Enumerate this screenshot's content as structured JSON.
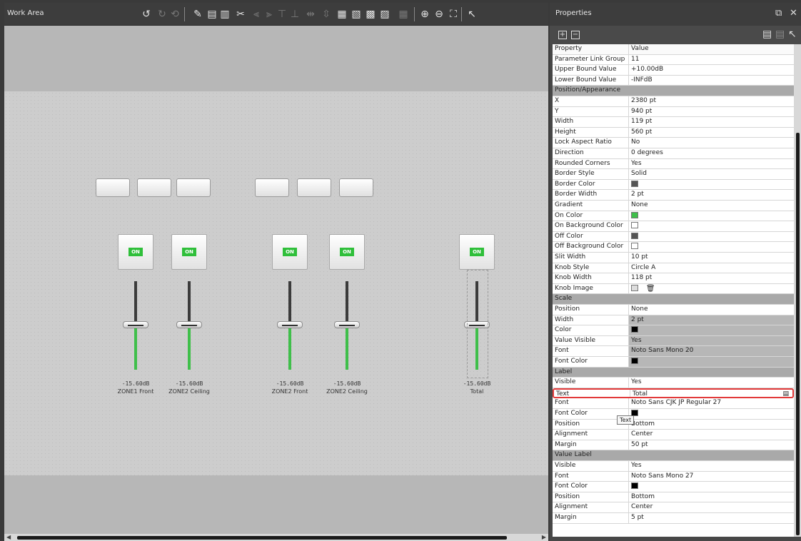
{
  "work_area": {
    "title": "Work Area",
    "toolbar": [
      "undo-icon",
      "redo-icon",
      "history-icon",
      "edit-icon",
      "copy-icon",
      "paste-icon",
      "cut-icon",
      "align-left-icon",
      "align-right-icon",
      "align-top-icon",
      "align-bottom-icon",
      "distribute-horizontal-icon",
      "distribute-vertical-icon",
      "group-icon",
      "ungroup-icon",
      "front-icon",
      "back-icon",
      "grid-icon",
      "zoom-in-icon",
      "zoom-out-icon",
      "fit-icon",
      "pointer-icon"
    ],
    "top_buttons": 6,
    "faders": [
      {
        "on_label": "ON",
        "value": "-15.60dB",
        "label": "ZONE1 Front",
        "level": 0.52
      },
      {
        "on_label": "ON",
        "value": "-15.60dB",
        "label": "ZONE2 Ceiling",
        "level": 0.52
      },
      {
        "on_label": "ON",
        "value": "-15.60dB",
        "label": "ZONE2 Front",
        "level": 0.52
      },
      {
        "on_label": "ON",
        "value": "-15.60dB",
        "label": "ZONE2 Ceiling",
        "level": 0.52
      },
      {
        "on_label": "ON",
        "value": "-15.60dB",
        "label": "Total",
        "level": 0.52
      }
    ]
  },
  "properties": {
    "title": "Properties",
    "header": {
      "property": "Property",
      "value": "Value"
    },
    "tooltip": "Text",
    "rows": [
      {
        "k": "Parameter Link Group",
        "v": "11"
      },
      {
        "k": "Upper Bound Value",
        "v": "+10.00dB"
      },
      {
        "k": "Lower Bound Value",
        "v": "-INFdB"
      },
      {
        "cat": "Position/Appearance"
      },
      {
        "k": "X",
        "v": "2380 pt"
      },
      {
        "k": "Y",
        "v": "940 pt"
      },
      {
        "k": "Width",
        "v": "119 pt"
      },
      {
        "k": "Height",
        "v": "560 pt"
      },
      {
        "k": "Lock Aspect Ratio",
        "v": "No"
      },
      {
        "k": "Direction",
        "v": "0 degrees"
      },
      {
        "k": "Rounded Corners",
        "v": "Yes"
      },
      {
        "k": "Border Style",
        "v": "Solid"
      },
      {
        "k": "Border Color",
        "swatch": "#555555"
      },
      {
        "k": "Border Width",
        "v": "2 pt"
      },
      {
        "k": "Gradient",
        "v": "None"
      },
      {
        "k": "On Color",
        "swatch": "#3fbf4a"
      },
      {
        "k": "On Background Color",
        "swatch": "#ffffff"
      },
      {
        "k": "Off Color",
        "swatch": "#555555"
      },
      {
        "k": "Off Background Color",
        "swatch": "#ffffff"
      },
      {
        "k": "Slit Width",
        "v": "10 pt"
      },
      {
        "k": "Knob Style",
        "v": "Circle A"
      },
      {
        "k": "Knob Width",
        "v": "118 pt"
      },
      {
        "k": "Knob Image",
        "knob": true
      },
      {
        "cat": "Scale"
      },
      {
        "k": "Position",
        "v": "None"
      },
      {
        "k": "Width",
        "v": "2 pt",
        "dim": true
      },
      {
        "k": "Color",
        "swatch": "#000000",
        "dim": true
      },
      {
        "k": "Value Visible",
        "v": "Yes",
        "dim": true
      },
      {
        "k": "Font",
        "v": "Noto Sans Mono 20",
        "dim": true
      },
      {
        "k": "Font Color",
        "swatch": "#000000",
        "dim": true
      },
      {
        "cat": "Label"
      },
      {
        "k": "Visible",
        "v": "Yes"
      },
      {
        "k": "Text",
        "v": "Total",
        "highlight": true
      },
      {
        "k": "Font",
        "v": "Noto Sans CJK JP Regular 27"
      },
      {
        "k": "Font Color",
        "swatch": "#000000"
      },
      {
        "k": "Position",
        "v": "Bottom"
      },
      {
        "k": "Alignment",
        "v": "Center"
      },
      {
        "k": "Margin",
        "v": "50 pt"
      },
      {
        "cat": "Value Label"
      },
      {
        "k": "Visible",
        "v": "Yes"
      },
      {
        "k": "Font",
        "v": "Noto Sans Mono 27"
      },
      {
        "k": "Font Color",
        "swatch": "#000000"
      },
      {
        "k": "Position",
        "v": "Bottom"
      },
      {
        "k": "Alignment",
        "v": "Center"
      },
      {
        "k": "Margin",
        "v": "5 pt"
      }
    ]
  }
}
